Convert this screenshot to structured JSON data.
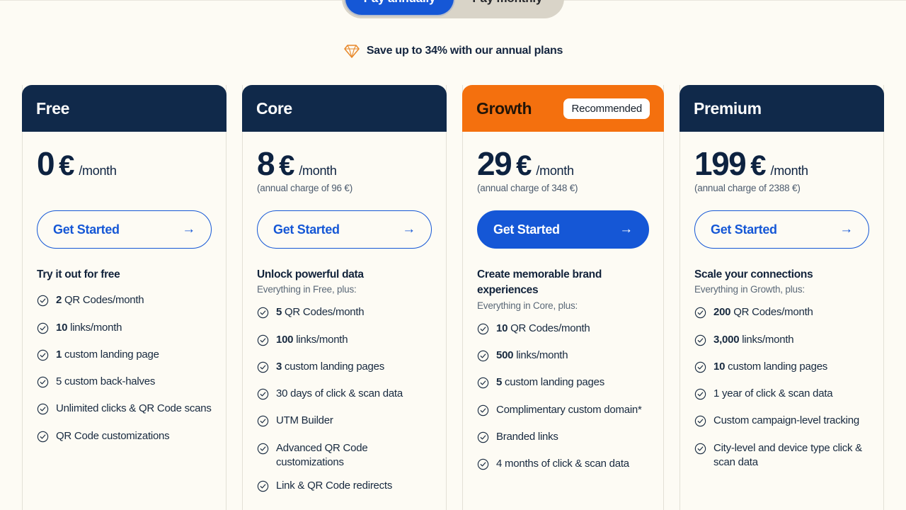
{
  "billing_toggle": {
    "annual_label": "Pay annually",
    "monthly_label": "Pay monthly",
    "active": "Pay annually"
  },
  "save_banner": {
    "icon": "gem-icon",
    "text": "Save up to 34% with our annual plans"
  },
  "colors": {
    "page_bg": "#fdfbf4",
    "navy": "#10294a",
    "orange": "#f4700e",
    "blue": "#1557d6",
    "muted": "#5a6877"
  },
  "plans": [
    {
      "name": "Free",
      "header_style": "navy",
      "badge": "",
      "price_amount": "0",
      "currency": "€",
      "period": "/month",
      "annual_note": "",
      "cta_label": "Get Started",
      "cta_style": "outline",
      "feature_heading": "Try it out for free",
      "feature_subheading": "",
      "features": [
        {
          "strong": "2",
          "text": "QR Codes/month"
        },
        {
          "strong": "10",
          "text": "links/month"
        },
        {
          "strong": "1",
          "text": "custom landing page"
        },
        {
          "strong": "",
          "text": "5 custom back-halves"
        },
        {
          "strong": "",
          "text": "Unlimited clicks & QR Code scans"
        },
        {
          "strong": "",
          "text": "QR Code customizations"
        }
      ]
    },
    {
      "name": "Core",
      "header_style": "navy",
      "badge": "",
      "price_amount": "8",
      "currency": "€",
      "period": "/month",
      "annual_note": "(annual charge of 96 €)",
      "cta_label": "Get Started",
      "cta_style": "outline",
      "feature_heading": "Unlock powerful data",
      "feature_subheading": "Everything in Free, plus:",
      "features": [
        {
          "strong": "5",
          "text": "QR Codes/month"
        },
        {
          "strong": "100",
          "text": "links/month"
        },
        {
          "strong": "3",
          "text": "custom landing pages"
        },
        {
          "strong": "",
          "text": "30 days of click & scan data"
        },
        {
          "strong": "",
          "text": "UTM Builder"
        },
        {
          "strong": "",
          "text": "Advanced QR Code customizations"
        },
        {
          "strong": "",
          "text": "Link & QR Code redirects"
        }
      ]
    },
    {
      "name": "Growth",
      "header_style": "orange",
      "badge": "Recommended",
      "price_amount": "29",
      "currency": "€",
      "period": "/month",
      "annual_note": "(annual charge of 348 €)",
      "cta_label": "Get Started",
      "cta_style": "solid",
      "feature_heading": "Create memorable brand experiences",
      "feature_subheading": "Everything in Core, plus:",
      "features": [
        {
          "strong": "10",
          "text": "QR Codes/month"
        },
        {
          "strong": "500",
          "text": "links/month"
        },
        {
          "strong": "5",
          "text": "custom landing pages"
        },
        {
          "strong": "",
          "text": "Complimentary custom domain*"
        },
        {
          "strong": "",
          "text": "Branded links"
        },
        {
          "strong": "",
          "text": "4 months of click & scan data"
        }
      ]
    },
    {
      "name": "Premium",
      "header_style": "navy",
      "badge": "",
      "price_amount": "199",
      "currency": "€",
      "period": "/month",
      "annual_note": "(annual charge of 2388 €)",
      "cta_label": "Get Started",
      "cta_style": "outline",
      "feature_heading": "Scale your connections",
      "feature_subheading": "Everything in Growth, plus:",
      "features": [
        {
          "strong": "200",
          "text": "QR Codes/month"
        },
        {
          "strong": "3,000",
          "text": "links/month"
        },
        {
          "strong": "10",
          "text": "custom landing pages"
        },
        {
          "strong": "",
          "text": "1 year of click & scan data"
        },
        {
          "strong": "",
          "text": "Custom campaign-level tracking"
        },
        {
          "strong": "",
          "text": "City-level and device type click & scan data"
        }
      ]
    }
  ]
}
